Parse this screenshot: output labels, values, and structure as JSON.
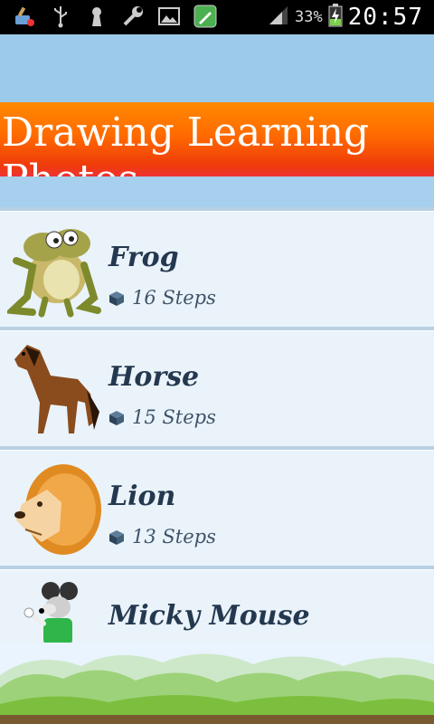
{
  "status_bar": {
    "icons": [
      "cleaner-app-icon",
      "usb-icon",
      "keyhole-icon",
      "wrench-icon",
      "gallery-icon",
      "edit-app-icon"
    ],
    "signal_icon": "signal-icon",
    "battery_percent": "33%",
    "battery_icon": "battery-charging-icon",
    "time": "20:57"
  },
  "header": {
    "title": "Drawing Learning Photos",
    "colors": {
      "orange": "#ff8a00",
      "red": "#ef3b0b",
      "sky": "#9ccaea"
    }
  },
  "items": [
    {
      "name": "Frog",
      "steps": "16 Steps",
      "icon": "frog-image"
    },
    {
      "name": "Horse",
      "steps": "15 Steps",
      "icon": "horse-image"
    },
    {
      "name": "Lion",
      "steps": "13 Steps",
      "icon": "lion-image"
    },
    {
      "name": "Micky Mouse",
      "steps": "",
      "icon": "mickey-mouse-image"
    }
  ],
  "steps_icon": "box-icon"
}
